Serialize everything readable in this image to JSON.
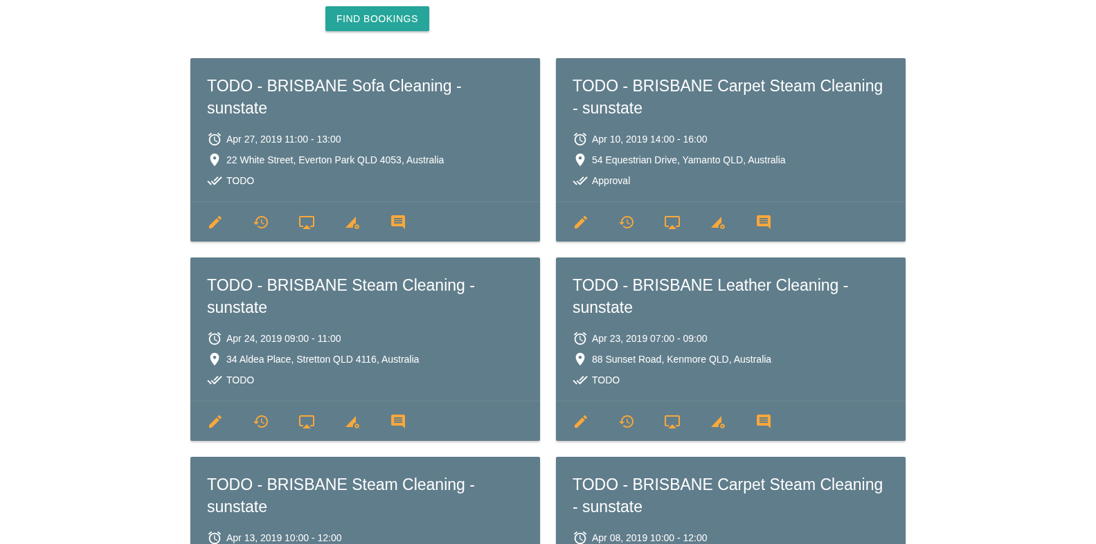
{
  "find_button": {
    "label": "FIND BOOKINGS"
  },
  "bookings": [
    {
      "title": "TODO - BRISBANE Sofa Cleaning - sunstate",
      "datetime": "Apr 27, 2019 11:00 - 13:00",
      "address": "22 White Street, Everton Park QLD 4053, Australia",
      "status": "TODO"
    },
    {
      "title": "TODO - BRISBANE Carpet Steam Cleaning - sunstate",
      "datetime": "Apr 10, 2019 14:00 - 16:00",
      "address": "54 Equestrian Drive, Yamanto QLD, Australia",
      "status": "Approval"
    },
    {
      "title": "TODO - BRISBANE Steam Cleaning - sunstate",
      "datetime": "Apr 24, 2019 09:00 - 11:00",
      "address": "34 Aldea Place, Stretton QLD 4116, Australia",
      "status": "TODO"
    },
    {
      "title": "TODO - BRISBANE Leather Cleaning - sunstate",
      "datetime": "Apr 23, 2019 07:00 - 09:00",
      "address": "88 Sunset Road, Kenmore QLD, Australia",
      "status": "TODO"
    },
    {
      "title": "TODO - BRISBANE Steam Cleaning - sunstate",
      "datetime": "Apr 13, 2019 10:00 - 12:00"
    },
    {
      "title": "TODO - BRISBANE Carpet Steam Cleaning - sunstate",
      "datetime": "Apr 08, 2019 10:00 - 12:00"
    }
  ]
}
